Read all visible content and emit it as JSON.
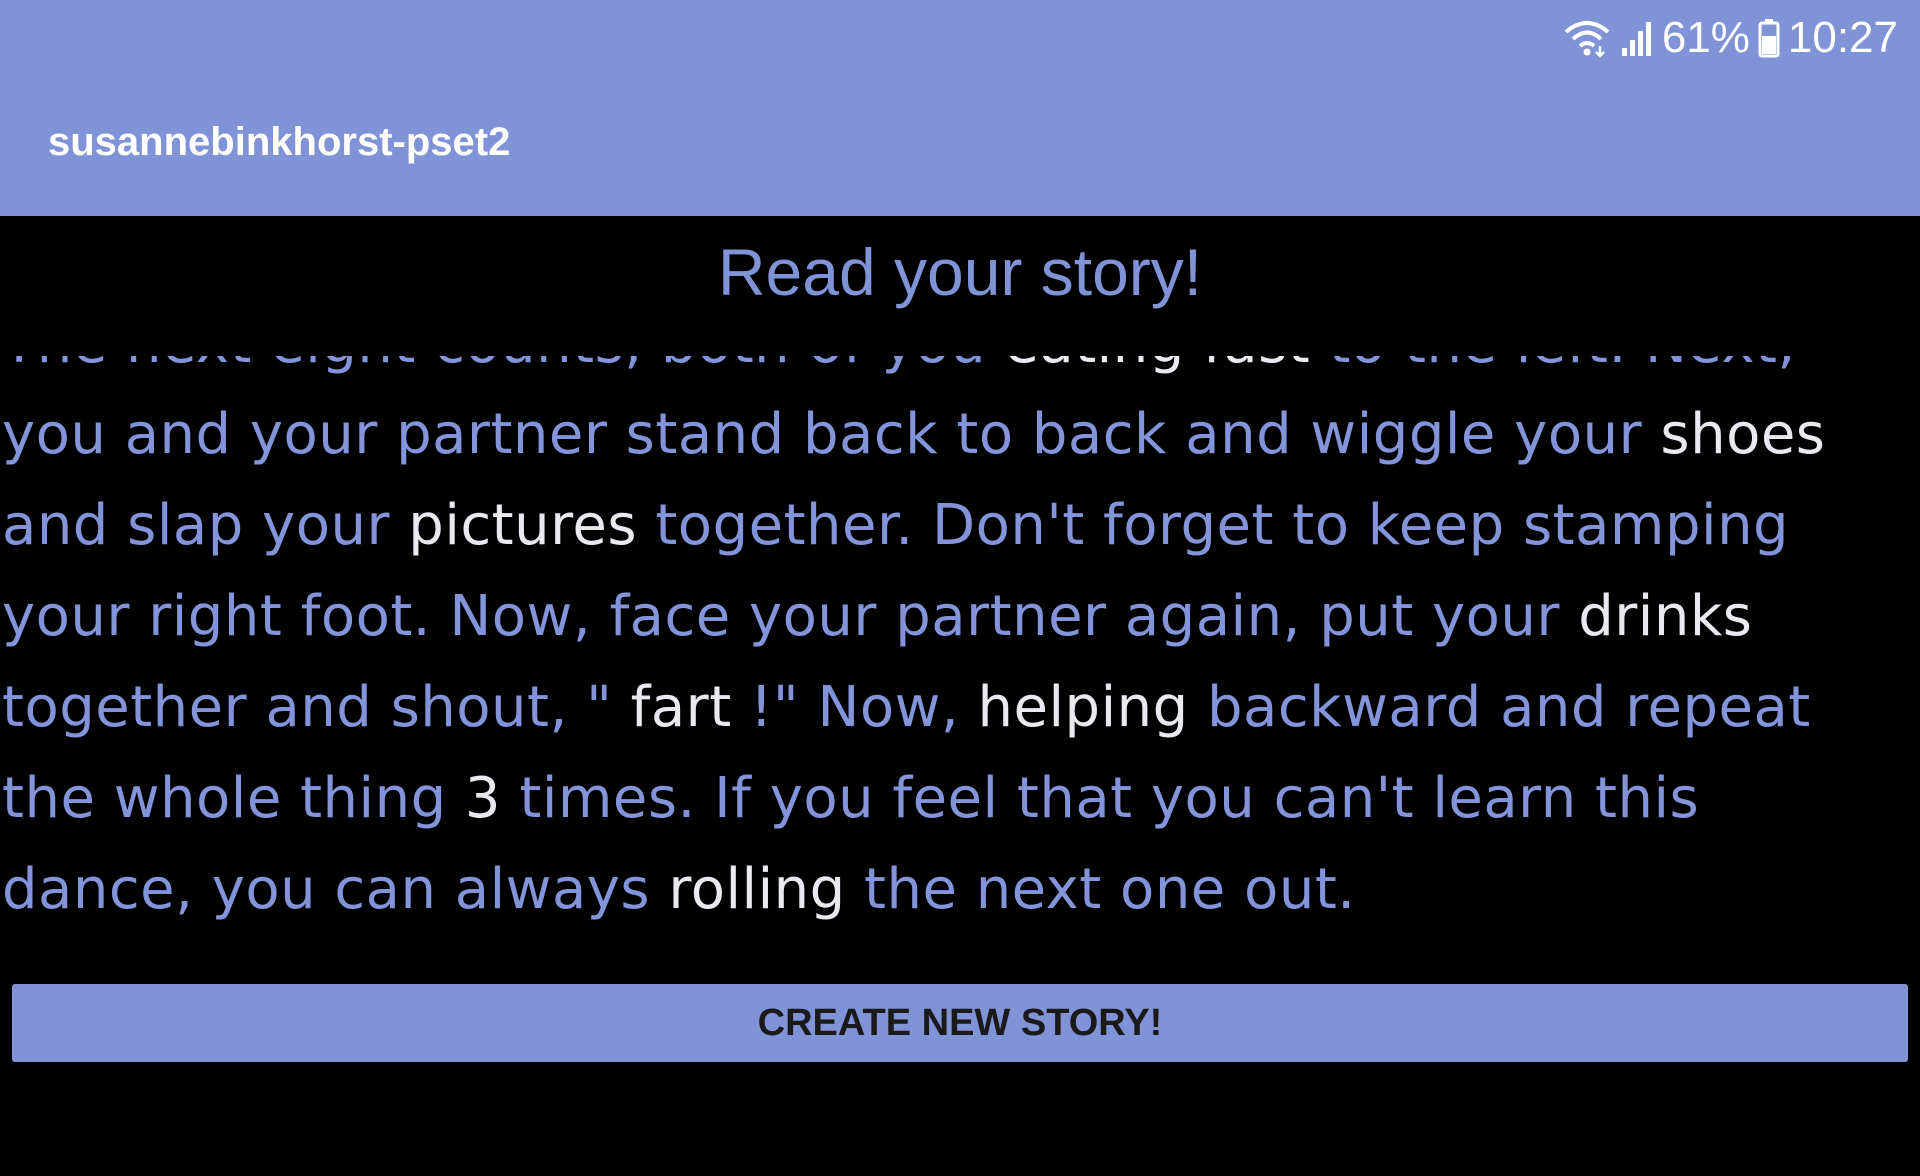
{
  "status_bar": {
    "battery": "61%",
    "time": "10:27",
    "icons": [
      "wifi-icon",
      "signal-icon",
      "battery-icon"
    ]
  },
  "app_bar": {
    "title": "susannebinkhorst-pset2"
  },
  "page": {
    "heading": "Read your story!"
  },
  "story": {
    "segments": [
      {
        "text": "The next eight counts, both of you ",
        "highlight": false
      },
      {
        "text": "eating fast",
        "highlight": true
      },
      {
        "text": " to the left. Next, you and your partner stand back to back and wiggle your ",
        "highlight": false
      },
      {
        "text": "shoes",
        "highlight": true
      },
      {
        "text": " and slap your ",
        "highlight": false
      },
      {
        "text": "pictures",
        "highlight": true
      },
      {
        "text": " together. Don't forget to keep stamping your right foot. Now, face your partner again, put your ",
        "highlight": false
      },
      {
        "text": "drinks",
        "highlight": true
      },
      {
        "text": " together and shout, \" ",
        "highlight": false
      },
      {
        "text": "fart",
        "highlight": true
      },
      {
        "text": " !\" Now, ",
        "highlight": false
      },
      {
        "text": "helping",
        "highlight": true
      },
      {
        "text": " backward and repeat the whole thing ",
        "highlight": false
      },
      {
        "text": "3",
        "highlight": true
      },
      {
        "text": " times. If you feel that you can't learn this dance, you can always ",
        "highlight": false
      },
      {
        "text": "rolling",
        "highlight": true
      },
      {
        "text": " the next one out.",
        "highlight": false
      }
    ]
  },
  "actions": {
    "create_new_story": "CREATE NEW STORY!"
  },
  "colors": {
    "accent": "#7f93d6",
    "story_text": "#8494db",
    "story_word": "#e8eaf0",
    "background": "#000000"
  }
}
